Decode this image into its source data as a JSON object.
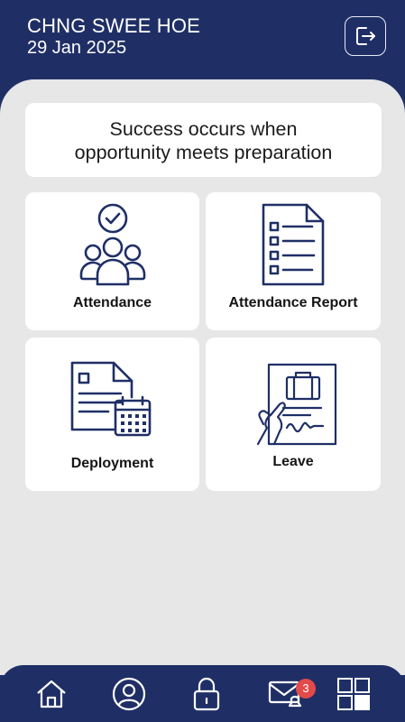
{
  "header": {
    "user_name": "CHNG SWEE HOE",
    "date": "29 Jan 2025"
  },
  "quote": {
    "line1": "Success occurs when",
    "line2": "opportunity meets preparation"
  },
  "tiles": [
    {
      "label": "Attendance",
      "icon": "attendance-group-icon"
    },
    {
      "label": "Attendance Report",
      "icon": "report-document-icon"
    },
    {
      "label": "Deployment",
      "icon": "deployment-calendar-icon"
    },
    {
      "label": "Leave",
      "icon": "leave-briefcase-document-icon"
    }
  ],
  "bottom_nav": {
    "items": [
      "home-icon",
      "profile-icon",
      "lock-icon",
      "messages-icon",
      "apps-grid-icon"
    ],
    "notification_count": "3"
  },
  "colors": {
    "primary": "#1f2f66",
    "background": "#e7e7e8",
    "card": "#ffffff",
    "badge": "#e34a4a"
  }
}
